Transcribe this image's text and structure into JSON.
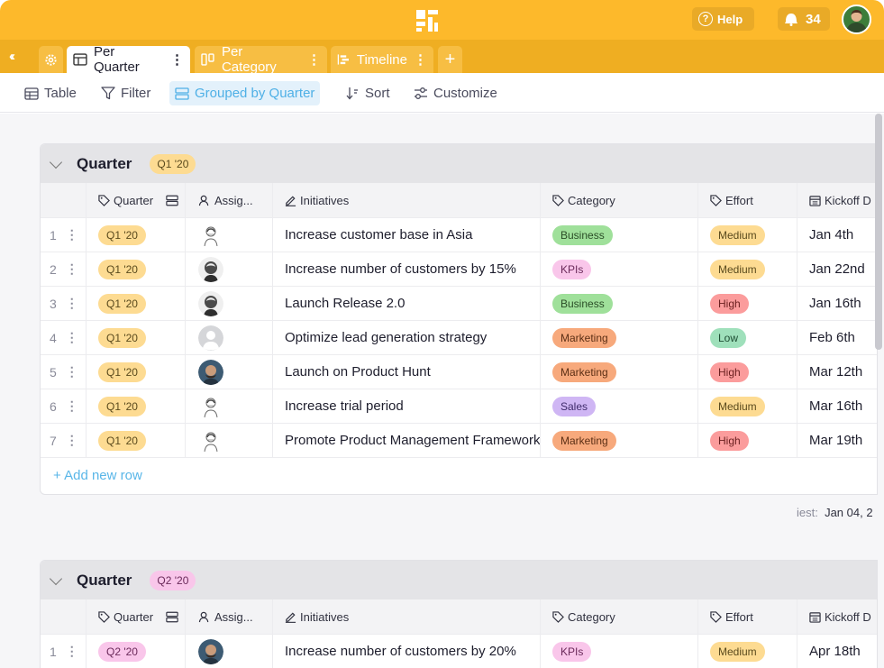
{
  "header": {
    "help_label": "Help",
    "notifications_count": "34"
  },
  "tabs": [
    {
      "label": "Per Quarter",
      "active": true
    },
    {
      "label": "Per Category",
      "active": false
    },
    {
      "label": "Timeline",
      "active": false
    }
  ],
  "toolbar": {
    "table_label": "Table",
    "filter_label": "Filter",
    "group_label": "Grouped by Quarter",
    "sort_label": "Sort",
    "customize_label": "Customize"
  },
  "columns": {
    "quarter": "Quarter",
    "assignee": "Assig...",
    "initiatives": "Initiatives",
    "category": "Category",
    "effort": "Effort",
    "kickoff": "Kickoff D"
  },
  "groups": [
    {
      "title": "Quarter",
      "badge": "Q1 '20",
      "rows": [
        {
          "num": "1",
          "quarter": "Q1 '20",
          "avatar": "sketch",
          "initiative": "Increase customer base in Asia",
          "category": "Business",
          "effort": "Medium",
          "kickoff": "Jan 4th"
        },
        {
          "num": "2",
          "quarter": "Q1 '20",
          "avatar": "bw",
          "initiative": "Increase number of customers by 15%",
          "category": "KPIs",
          "effort": "Medium",
          "kickoff": "Jan 22nd"
        },
        {
          "num": "3",
          "quarter": "Q1 '20",
          "avatar": "bw",
          "initiative": "Launch Release 2.0",
          "category": "Business",
          "effort": "High",
          "kickoff": "Jan 16th"
        },
        {
          "num": "4",
          "quarter": "Q1 '20",
          "avatar": "gray",
          "initiative": "Optimize lead generation strategy",
          "category": "Marketing",
          "effort": "Low",
          "kickoff": "Feb 6th"
        },
        {
          "num": "5",
          "quarter": "Q1 '20",
          "avatar": "photo",
          "initiative": "Launch on Product Hunt",
          "category": "Marketing",
          "effort": "High",
          "kickoff": "Mar 12th"
        },
        {
          "num": "6",
          "quarter": "Q1 '20",
          "avatar": "sketch",
          "initiative": "Increase trial period",
          "category": "Sales",
          "effort": "Medium",
          "kickoff": "Mar 16th"
        },
        {
          "num": "7",
          "quarter": "Q1 '20",
          "avatar": "sketch",
          "initiative": "Promote Product Management Framework",
          "category": "Marketing",
          "effort": "High",
          "kickoff": "Mar 19th"
        }
      ],
      "add_row_label": "+ Add new row",
      "footer_label": "iest:",
      "footer_value": "Jan 04, 2"
    },
    {
      "title": "Quarter",
      "badge": "Q2 '20",
      "rows": [
        {
          "num": "1",
          "quarter": "Q2 '20",
          "avatar": "photo",
          "initiative": "Increase number of customers by 20%",
          "category": "KPIs",
          "effort": "Medium",
          "kickoff": "Apr 18th"
        }
      ]
    }
  ]
}
